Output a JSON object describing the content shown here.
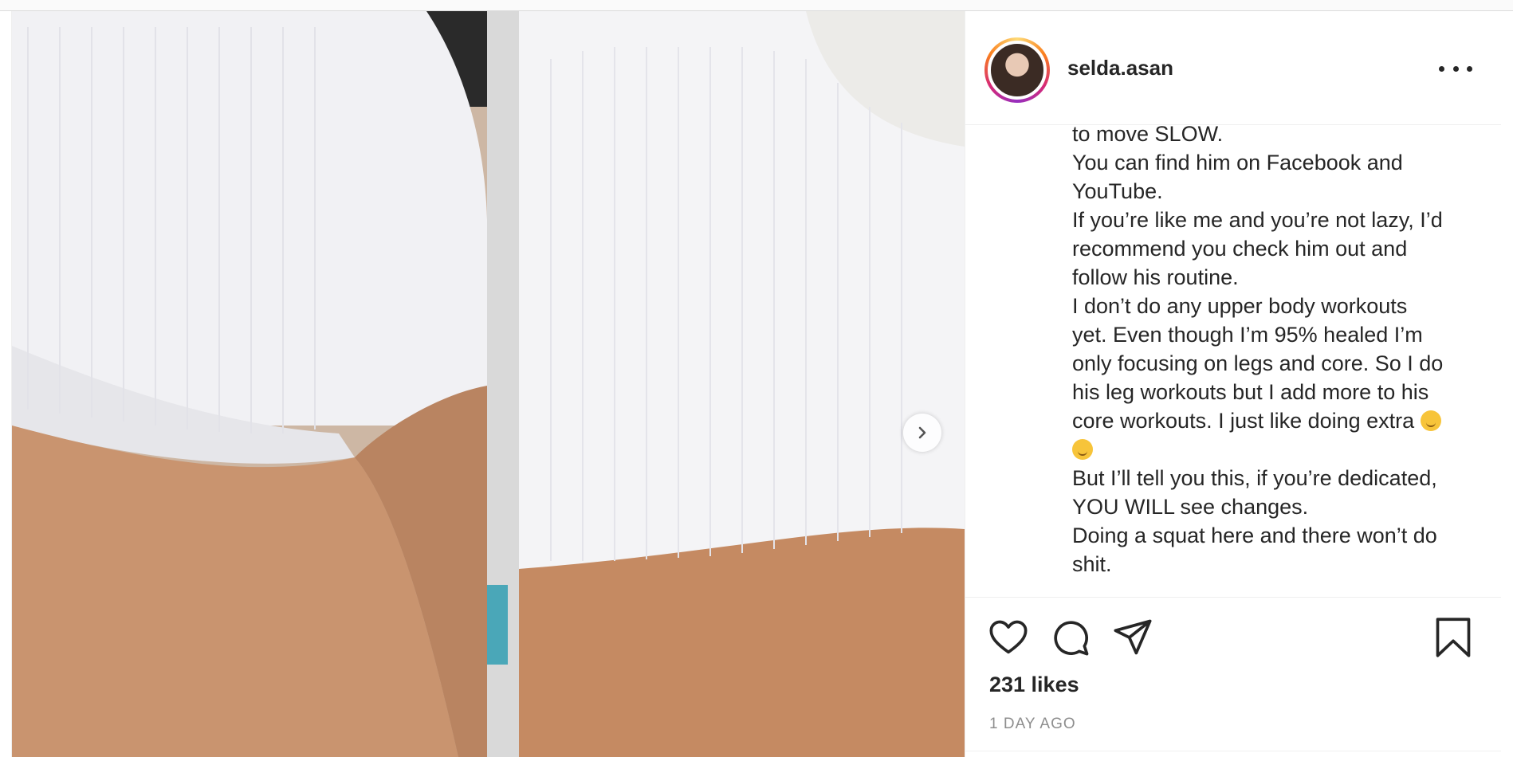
{
  "post": {
    "username": "selda.asan",
    "more_label": "More options",
    "next_label": "Next",
    "caption_lines": [
      "to move SLOW.",
      "You can find him on Facebook and",
      "YouTube.",
      "If you’re like me and you’re not lazy, I’d",
      "recommend you check him out and",
      "follow his routine.",
      "I don’t do any upper body workouts",
      "yet. Even though I’m 95% healed I’m",
      "only focusing on legs and core. So I do",
      "his leg workouts but I add more to his",
      "core workouts. I just like doing extra",
      "",
      "But I’ll tell you this, if you’re dedicated,",
      "YOU WILL see changes.",
      "Doing a squat here and there won’t do",
      "shit."
    ],
    "likes": "231 likes",
    "timestamp": "1 DAY AGO"
  },
  "icons": {
    "like": "heart-icon",
    "comment": "comment-icon",
    "share": "send-icon",
    "save": "bookmark-icon",
    "more": "ellipsis-icon",
    "next": "chevron-right-icon"
  },
  "colors": {
    "text": "#262626",
    "muted": "#8e8e8e",
    "border": "#efefef",
    "story_ring": [
      "#feda75",
      "#fa7e1e",
      "#d62976",
      "#962fbf"
    ]
  }
}
